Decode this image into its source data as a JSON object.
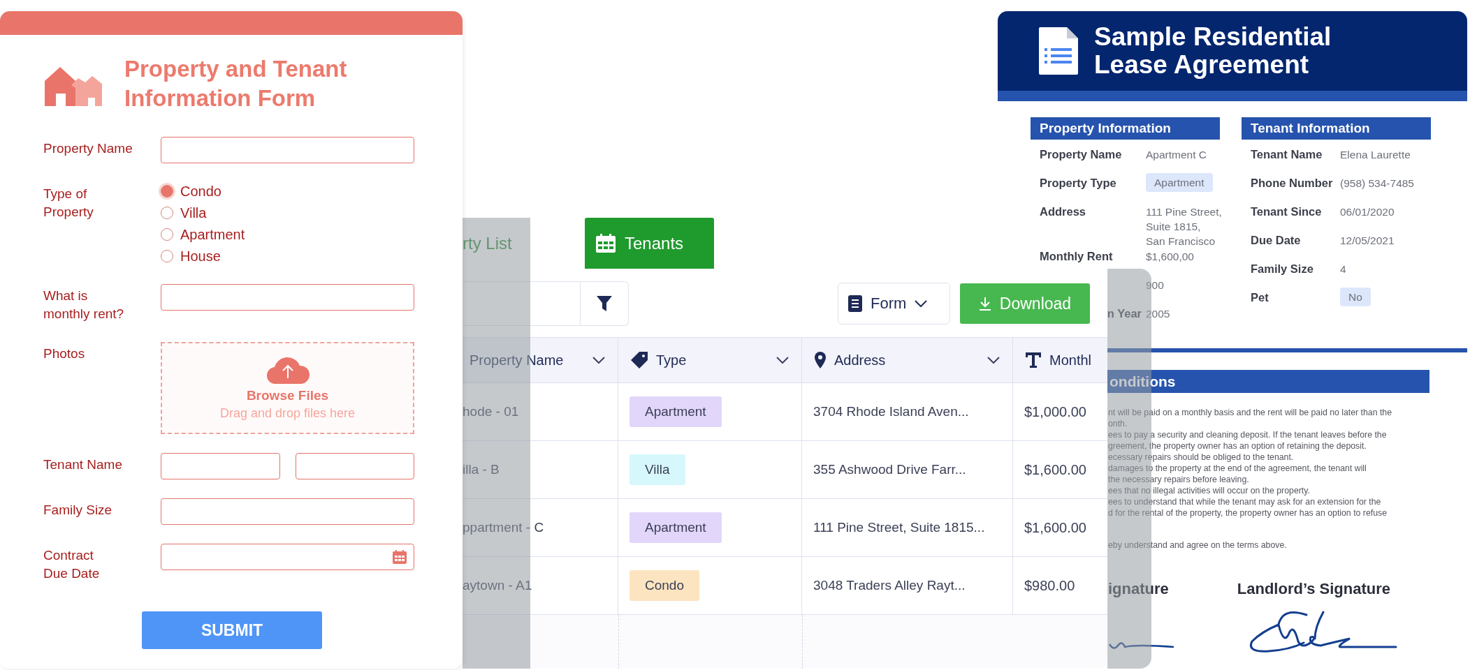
{
  "form": {
    "title_lines": [
      "Property and Tenant",
      "Information Form"
    ],
    "fields": [
      {
        "kind": "text",
        "label_lines": [
          "Property Name"
        ]
      },
      {
        "kind": "radio",
        "label_lines": [
          "Type of",
          "Property"
        ],
        "options": [
          {
            "label": "Condo",
            "selected": true
          },
          {
            "label": "Villa",
            "selected": false
          },
          {
            "label": "Apartment",
            "selected": false
          },
          {
            "label": "House",
            "selected": false
          }
        ]
      },
      {
        "kind": "text",
        "label_lines": [
          "What is",
          "monthly rent?"
        ]
      },
      {
        "kind": "upload",
        "label_lines": [
          "Photos"
        ],
        "button": "Browse Files",
        "hint": "Drag and drop files here"
      },
      {
        "kind": "split",
        "label_lines": [
          "Tenant Name"
        ]
      },
      {
        "kind": "text",
        "label_lines": [
          "Family Size"
        ]
      },
      {
        "kind": "date",
        "label_lines": [
          "Contract",
          "Due Date"
        ]
      }
    ],
    "submit": "SUBMIT"
  },
  "table": {
    "tabs": [
      {
        "label": "rty List",
        "selected": false
      },
      {
        "label": "Tenants",
        "selected": true
      }
    ],
    "view_select": "Form",
    "download": "Download",
    "columns": [
      {
        "label": "Property Name",
        "kind": "name",
        "menu": true
      },
      {
        "label": "Type",
        "kind": "type",
        "menu": true
      },
      {
        "label": "Address",
        "kind": "address",
        "menu": true
      },
      {
        "label": "Monthl",
        "kind": "amount",
        "menu": false
      }
    ],
    "rows": [
      {
        "name": "hode - 01",
        "type": "Apartment",
        "color": "#e2d6fb",
        "address": "3704 Rhode Island Aven...",
        "rent": "$1,000.00"
      },
      {
        "name": "illa - B",
        "type": "Villa",
        "color": "#d6f7fb",
        "address": "355 Ashwood Drive Farr...",
        "rent": "$1,600.00"
      },
      {
        "name": "ppartment - C",
        "type": "Apartment",
        "color": "#e2d6fb",
        "address": "111 Pine Street, Suite 1815...",
        "rent": "$1,600.00"
      },
      {
        "name": "aytown - A1",
        "type": "Condo",
        "color": "#fde4c0",
        "address": "3048 Traders Alley Rayt...",
        "rent": "$980.00"
      }
    ]
  },
  "document": {
    "title_lines": [
      "Sample Residential",
      "Lease Agreement"
    ],
    "sections": [
      {
        "heading": "Property Information",
        "rows": [
          {
            "kind": "text",
            "label": "Property Name",
            "lines": [
              "Apartment C"
            ]
          },
          {
            "kind": "badge",
            "label": "Property Type",
            "lines": [
              "Apartment"
            ]
          },
          {
            "kind": "text",
            "label": "Address",
            "lines": [
              "111 Pine Street,",
              "Suite 1815,",
              "San Francisco"
            ]
          },
          {
            "kind": "text",
            "label": "Monthly Rent",
            "lines": [
              "$1,600,00"
            ]
          },
          {
            "kind": "text",
            "lines": [
              "900"
            ]
          },
          {
            "kind": "text",
            "label": "n Year",
            "lines": [
              "2005"
            ]
          }
        ]
      },
      {
        "heading": "Tenant Information",
        "rows": [
          {
            "kind": "text",
            "label": "Tenant Name",
            "lines": [
              "Elena Laurette"
            ]
          },
          {
            "kind": "text",
            "label": "Phone Number",
            "lines": [
              "(958) 534-7485"
            ]
          },
          {
            "kind": "text",
            "label": "Tenant Since",
            "lines": [
              "06/01/2020"
            ]
          },
          {
            "kind": "text",
            "label": "Due Date",
            "lines": [
              "12/05/2021"
            ]
          },
          {
            "kind": "text",
            "label": "Family Size",
            "lines": [
              "4"
            ]
          },
          {
            "kind": "badge",
            "label": "Pet",
            "lines": [
              "No"
            ]
          }
        ]
      }
    ],
    "conditions_heading": "onditions",
    "conditions": [
      [
        "nt will be paid on a monthly basis and the rent will be paid no later than the",
        "onth.",
        "ees to pay a security and cleaning deposit. If the tenant leaves before the",
        "greement, the property owner has an option of retaining the deposit.",
        "ecessary repairs should be obliged to the tenant.",
        "damages to the property at the end of the agreement, the tenant will",
        "the necessary repairs before leaving.",
        "ees that no illegal activities will occur on the property.",
        "ees to understand that while the tenant may ask for an extension for the",
        "d for the rental of the property, the property owner has an option to refuse"
      ],
      [
        "eby understand and agree on the terms above."
      ]
    ],
    "signatures": [
      "ignature",
      "Landlord’s Signature"
    ]
  }
}
